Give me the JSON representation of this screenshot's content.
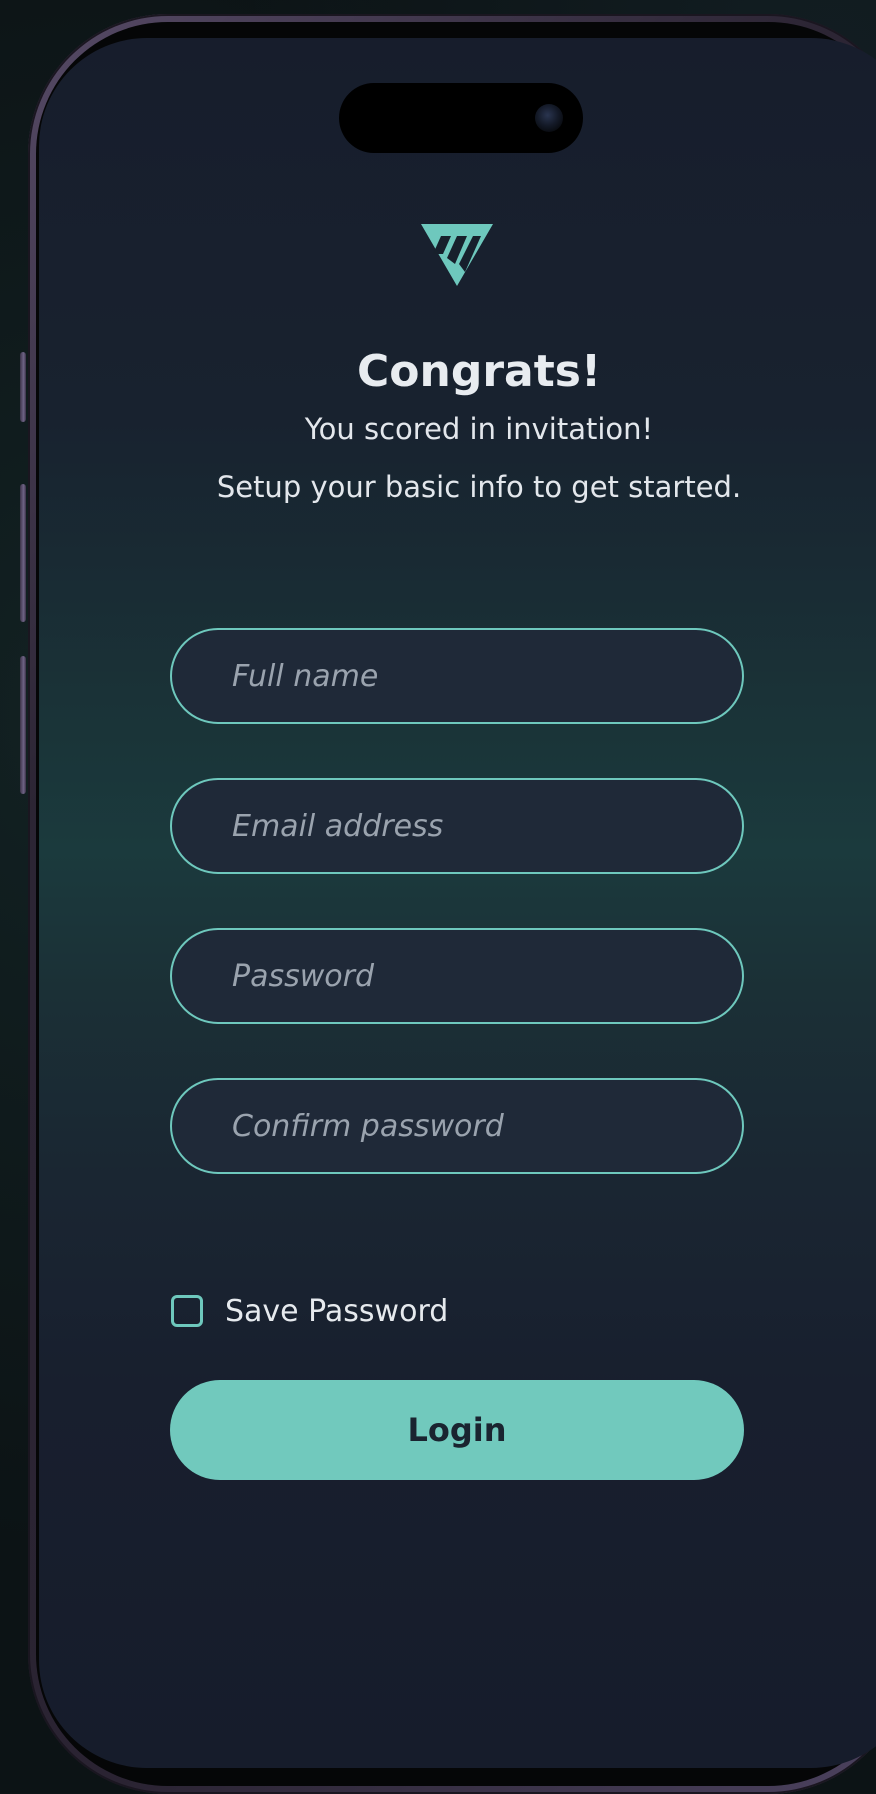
{
  "app": {
    "logo_icon": "teal-triangle-m-logo",
    "accent_color": "#71c9bd"
  },
  "header": {
    "title": "Congrats!",
    "subtitle_line1": "You scored in invitation!",
    "subtitle_line2": "Setup your basic info to get started."
  },
  "form": {
    "full_name": {
      "value": "",
      "placeholder": "Full name"
    },
    "email": {
      "value": "",
      "placeholder": "Email address"
    },
    "password": {
      "value": "",
      "placeholder": "Password"
    },
    "confirm_password": {
      "value": "",
      "placeholder": "Confirm password"
    },
    "save_password": {
      "label": "Save Password",
      "checked": false
    },
    "login_label": "Login"
  }
}
